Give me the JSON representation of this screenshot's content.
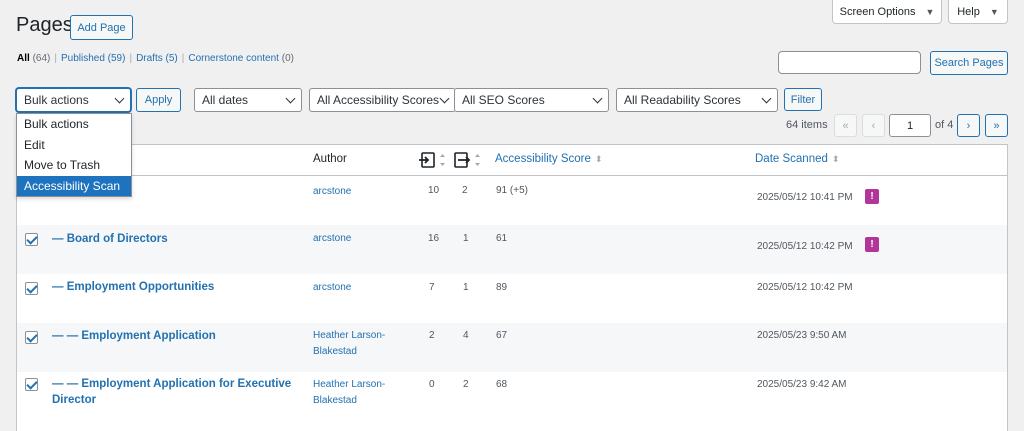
{
  "header": {
    "title": "Pages",
    "add_label": "Add Page",
    "screen_options": "Screen Options",
    "help": "Help"
  },
  "views": {
    "all": "All",
    "all_count": "(64)",
    "published": "Published (59)",
    "drafts": "Drafts (5)",
    "cornerstone": "Cornerstone content",
    "cornerstone_count": "(0)",
    "separator": "|"
  },
  "search": {
    "value": "",
    "button": "Search Pages"
  },
  "filters": {
    "bulk_actions": "Bulk actions",
    "apply": "Apply",
    "dates": "All dates",
    "accessibility": "All Accessibility Scores",
    "seo": "All SEO Scores",
    "readability": "All Readability Scores",
    "filter": "Filter"
  },
  "bulk_menu": [
    "Bulk actions",
    "Edit",
    "Move to Trash",
    "Accessibility Scan"
  ],
  "pagination": {
    "items": "64 items",
    "first": "«",
    "prev": "‹",
    "current": "1",
    "of": "of 4",
    "next": "›",
    "last": "»"
  },
  "table": {
    "headers": {
      "author": "Author",
      "accessibility": "Accessibility Score",
      "date": "Date Scanned"
    },
    "rows": [
      {
        "title": "",
        "author": "arcstone",
        "c1": "10",
        "c2": "2",
        "score": "91 (+5)",
        "date": "2025/05/12 10:41 PM",
        "checked": true,
        "flag": true
      },
      {
        "title": "— Board of Directors",
        "author": "arcstone",
        "c1": "16",
        "c2": "1",
        "score": "61",
        "date": "2025/05/12 10:42 PM",
        "checked": true,
        "flag": true
      },
      {
        "title": "— Employment Opportunities",
        "author": "arcstone",
        "c1": "7",
        "c2": "1",
        "score": "89",
        "date": "2025/05/12 10:42 PM",
        "checked": true,
        "flag": false
      },
      {
        "title": "— — Employment Application",
        "author": "Heather Larson-Blakestad",
        "c1": "2",
        "c2": "4",
        "score": "67",
        "date": "2025/05/23 9:50 AM",
        "checked": true,
        "flag": false
      },
      {
        "title": "— — Employment Application for Executive Director",
        "author": "Heather Larson-Blakestad",
        "c1": "0",
        "c2": "2",
        "score": "68",
        "date": "2025/05/23 9:42 AM",
        "checked": true,
        "flag": false
      }
    ]
  },
  "colors": {
    "link": "#2271b1",
    "flag": "#b2359a",
    "selected": "#1e73be"
  },
  "icons": [
    "incoming-links-icon",
    "outgoing-links-icon",
    "sort-arrows-icon",
    "alert-flag-icon",
    "chevron-down-icon"
  ]
}
